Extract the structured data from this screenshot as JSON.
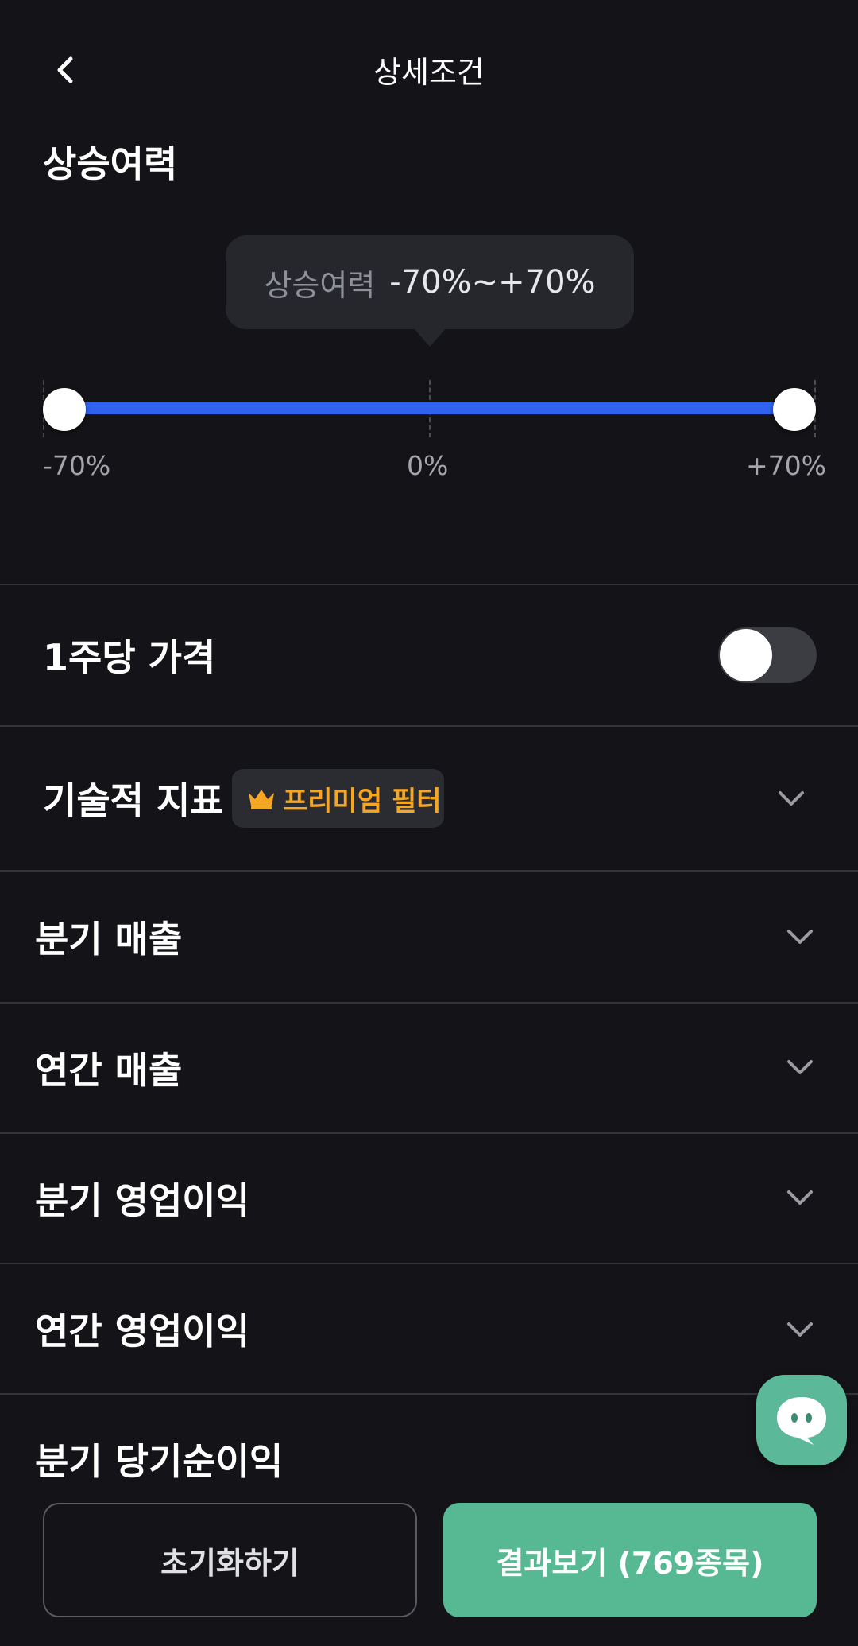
{
  "header": {
    "title": "상세조건",
    "back_icon": "chevron-left-icon"
  },
  "upside": {
    "section_title": "상승여력",
    "tooltip_label": "상승여력",
    "tooltip_value": "-70%~+70%",
    "range_min_label": "-70%",
    "range_mid_label": "0%",
    "range_max_label": "+70%",
    "selected_min_pct": -70,
    "selected_max_pct": 70
  },
  "price_per_share": {
    "label": "1주당 가격",
    "toggle_on": false
  },
  "technical": {
    "label": "기술적 지표",
    "badge_icon": "crown-icon",
    "badge_text": "프리미엄 필터"
  },
  "filters": [
    {
      "label": "분기 매출"
    },
    {
      "label": "연간 매출"
    },
    {
      "label": "분기 영업이익"
    },
    {
      "label": "연간 영업이익"
    },
    {
      "label": "분기 당기순이익"
    }
  ],
  "chat": {
    "icon": "chat-bubble-icon"
  },
  "bottom": {
    "reset_label": "초기화하기",
    "result_label": "결과보기 (769종목)"
  },
  "colors": {
    "background": "#141418",
    "accent_blue": "#2f63ef",
    "accent_green": "#57b993",
    "premium_gold": "#f5a623"
  }
}
